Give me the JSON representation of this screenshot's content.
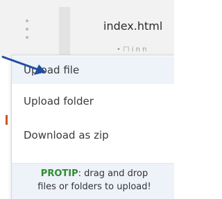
{
  "file_tree": {
    "file_name": "index.html",
    "file_subtext": "• □ i n n"
  },
  "menu": {
    "items": [
      {
        "label": "Upload file"
      },
      {
        "label": "Upload folder"
      },
      {
        "label": "Download as zip"
      }
    ],
    "protip": {
      "tag": "PROTIP",
      "text_line1": ": drag and drop",
      "text_line2": "files or folders to upload!"
    }
  },
  "colors": {
    "arrow": "#1f4fa3",
    "protip_tag": "#2e8b2e",
    "active_item_bg": "#eef2f9"
  }
}
